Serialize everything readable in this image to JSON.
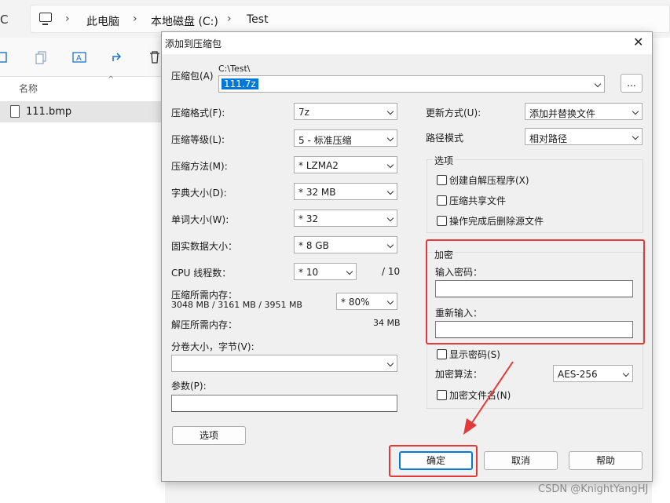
{
  "explorer": {
    "refresh_glyph": "C",
    "breadcrumb": [
      "此电脑",
      "本地磁盘 (C:)",
      "Test"
    ],
    "column_name": "名称",
    "file_name": "111.bmp"
  },
  "dialog": {
    "title": "添加到压缩包",
    "archive_label": "压缩包(A)",
    "archive_path": "C:\\Test\\",
    "archive_name": "111.7z",
    "browse_label": "...",
    "rows": [
      {
        "label": "压缩格式(F):",
        "value": "7z"
      },
      {
        "label": "压缩等级(L):",
        "value": "5 - 标准压缩"
      },
      {
        "label": "压缩方法(M):",
        "value": "*  LZMA2"
      },
      {
        "label": "字典大小(D):",
        "value": "*  32 MB"
      },
      {
        "label": "单词大小(W):",
        "value": "*  32"
      },
      {
        "label": "固实数据大小：",
        "value": "*  8 GB"
      }
    ],
    "cpu_label": "CPU 线程数：",
    "cpu_value": "*  10",
    "cpu_total": "/ 10",
    "mem_compress_label": "压缩所需内存：",
    "mem_compress_values": "3048 MB / 3161 MB / 3951 MB",
    "mem_percent": "*  80%",
    "mem_decompress_label": "解压所需内存：",
    "mem_decompress_value": "34 MB",
    "split_label": "分卷大小，字节(V):",
    "split_value": "",
    "params_label": "参数(P):",
    "params_value": "",
    "options_button": "选项",
    "update_label": "更新方式(U):",
    "update_value": "添加并替换文件",
    "path_mode_label": "路径模式",
    "path_mode_value": "相对路径",
    "options_group": "选项",
    "opt_sfx": "创建自解压程序(X)",
    "opt_shared": "压缩共享文件",
    "opt_delete": "操作完成后删除源文件",
    "encryption_group": "加密",
    "password_label": "输入密码：",
    "password_value": "",
    "reenter_label": "重新输入：",
    "reenter_value": "",
    "show_password": "显示密码(S)",
    "enc_method_label": "加密算法：",
    "enc_method_value": "AES-256",
    "encrypt_names": "加密文件名(N)",
    "ok_button": "确定",
    "cancel_button": "取消",
    "help_button": "帮助"
  },
  "watermark": "CSDN @KnightYangHJ",
  "colors": {
    "highlight": "#e23a3a",
    "selection": "#0078d7"
  }
}
